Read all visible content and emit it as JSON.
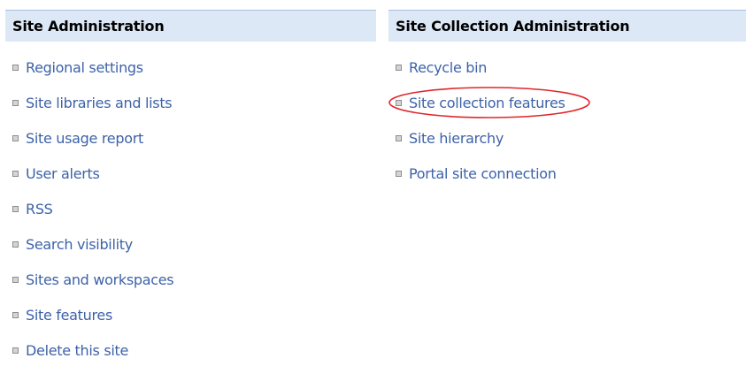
{
  "site_administration": {
    "title": "Site Administration",
    "links": [
      {
        "label": "Regional settings"
      },
      {
        "label": "Site libraries and lists"
      },
      {
        "label": "Site usage report"
      },
      {
        "label": "User alerts"
      },
      {
        "label": "RSS"
      },
      {
        "label": "Search visibility"
      },
      {
        "label": "Sites and workspaces"
      },
      {
        "label": "Site features"
      },
      {
        "label": "Delete this site"
      }
    ]
  },
  "site_collection_administration": {
    "title": "Site Collection Administration",
    "links": [
      {
        "label": "Recycle bin"
      },
      {
        "label": "Site collection features",
        "highlighted": true
      },
      {
        "label": "Site hierarchy"
      },
      {
        "label": "Portal site connection"
      }
    ]
  },
  "colors": {
    "header_background": "#dde8f6",
    "link_text": "#3d62a8",
    "highlight_ellipse": "#e0262b"
  },
  "icons": {
    "bullet": "square-bullet-icon"
  }
}
